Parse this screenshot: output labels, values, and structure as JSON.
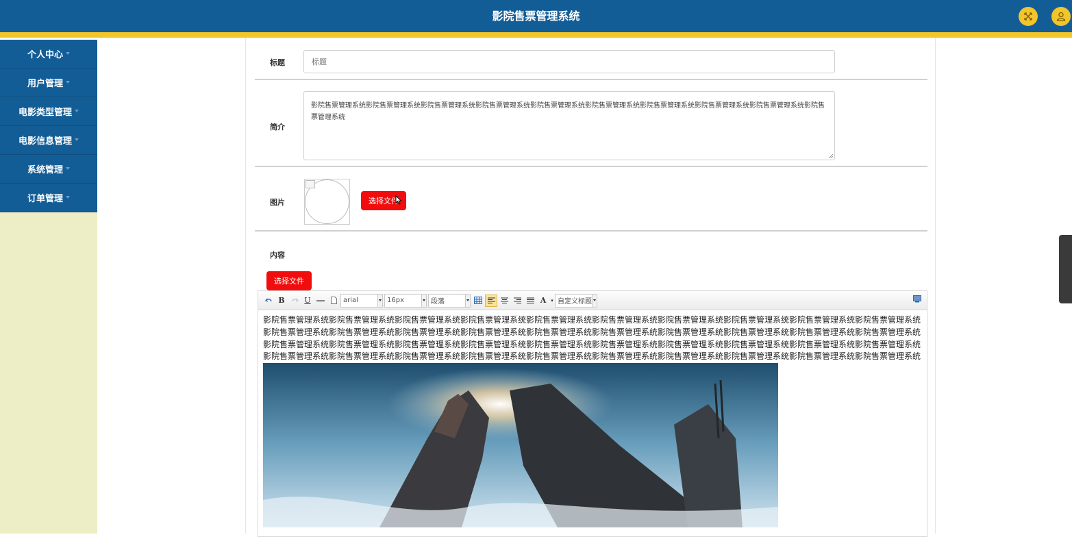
{
  "header": {
    "title": "影院售票管理系统",
    "expand_icon": "expand-icon",
    "user_icon": "user-icon"
  },
  "sidebar": {
    "items": [
      {
        "label": "个人中心"
      },
      {
        "label": "用户管理"
      },
      {
        "label": "电影类型管理"
      },
      {
        "label": "电影信息管理"
      },
      {
        "label": "系统管理"
      },
      {
        "label": "订单管理"
      }
    ]
  },
  "form": {
    "title_label": "标题",
    "title_placeholder": "标题",
    "intro_label": "简介",
    "intro_value": "影院售票管理系统影院售票管理系统影院售票管理系统影院售票管理系统影院售票管理系统影院售票管理系统影院售票管理系统影院售票管理系统影院售票管理系统影院售票管理系统",
    "image_label": "图片",
    "image_button": "选择文件",
    "content_label": "内容",
    "content_button": "选择文件"
  },
  "editor": {
    "font_family": "arial",
    "font_size": "16px",
    "paragraph": "段落",
    "custom_heading": "自定义标题",
    "body_text": "影院售票管理系统影院售票管理系统影院售票管理系统影院售票管理系统影院售票管理系统影院售票管理系统影院售票管理系统影院售票管理系统影院售票管理系统影院售票管理系统影院售票管理系统影院售票管理系统影院售票管理系统影院售票管理系统影院售票管理系统影院售票管理系统影院售票管理系统影院售票管理系统影院售票管理系统影院售票管理系统影院售票管理系统影院售票管理系统影院售票管理系统影院售票管理系统影院售票管理系统影院售票管理系统影院售票管理系统影院售票管理系统影院售票管理系统影院售票管理系统影院售票管理系统影院售票管理系统影院售票管理系统影院售票管理系统影院售票管理系统影院售票管理系统影院售票管理系统影院售票管理系统影院售票管理系统影院售票管理系统"
  },
  "colors": {
    "header": "#135d96",
    "accent_stripe": "#f2c52a",
    "sidebar_bg": "#eeeec6",
    "button_red": "#f10d0d"
  }
}
